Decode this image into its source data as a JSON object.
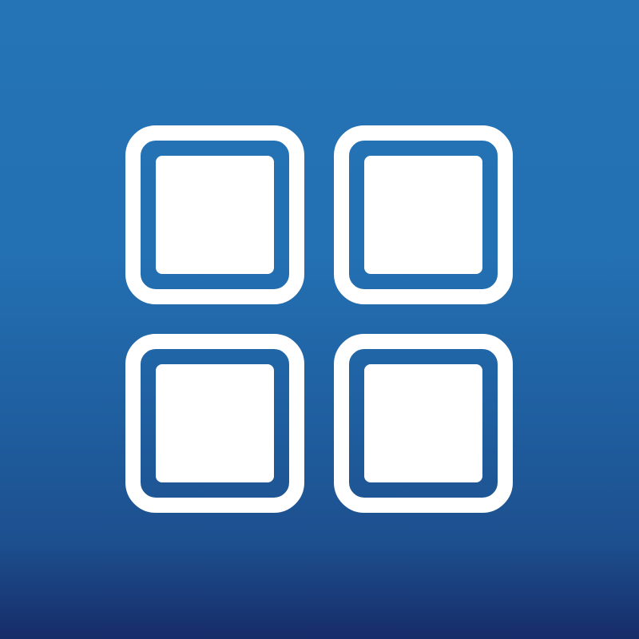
{
  "icon": {
    "name": "grid-icon",
    "description_colors": {
      "background_top": "#2474b6",
      "background_bottom": "#172c69",
      "glyph": "#ffffff"
    },
    "tiles": [
      {
        "id": "top-left"
      },
      {
        "id": "top-right"
      },
      {
        "id": "bottom-left"
      },
      {
        "id": "bottom-right"
      }
    ]
  }
}
